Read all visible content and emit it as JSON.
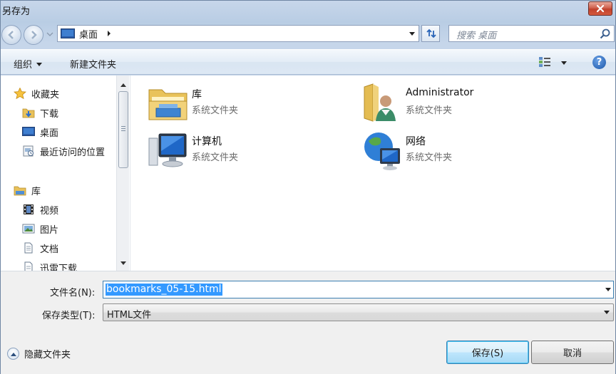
{
  "window": {
    "title": "另存为"
  },
  "address": {
    "location": "桌面"
  },
  "search": {
    "placeholder": "搜索 桌面"
  },
  "toolbar": {
    "organize_label": "组织",
    "new_folder_label": "新建文件夹",
    "help_label": "?"
  },
  "sidebar": {
    "favorites_label": "收藏夹",
    "favorites": [
      {
        "label": "下载",
        "icon": "download-folder-icon"
      },
      {
        "label": "桌面",
        "icon": "desktop-icon"
      },
      {
        "label": "最近访问的位置",
        "icon": "recent-places-icon"
      }
    ],
    "libraries_label": "库",
    "libraries": [
      {
        "label": "视频",
        "icon": "video-icon"
      },
      {
        "label": "图片",
        "icon": "pictures-icon"
      },
      {
        "label": "文档",
        "icon": "documents-icon"
      },
      {
        "label": "迅雷下载",
        "icon": "xunlei-download-icon"
      }
    ]
  },
  "files": [
    {
      "name": "库",
      "type": "系统文件夹",
      "icon": "libraries-folder-icon"
    },
    {
      "name": "Administrator",
      "type": "系统文件夹",
      "icon": "user-folder-icon"
    },
    {
      "name": "计算机",
      "type": "系统文件夹",
      "icon": "computer-icon"
    },
    {
      "name": "网络",
      "type": "系统文件夹",
      "icon": "network-icon"
    }
  ],
  "form": {
    "filename_label": "文件名(N):",
    "filename_value": "bookmarks_05-15.html",
    "filetype_label": "保存类型(T):",
    "filetype_value": "HTML文件"
  },
  "footer": {
    "hide_folders_label": "隐藏文件夹",
    "save_label": "保存(S)",
    "cancel_label": "取消"
  },
  "colors": {
    "selection": "#3399ff",
    "close_button": "#c1412c",
    "accent_border": "#3c7fb1"
  }
}
